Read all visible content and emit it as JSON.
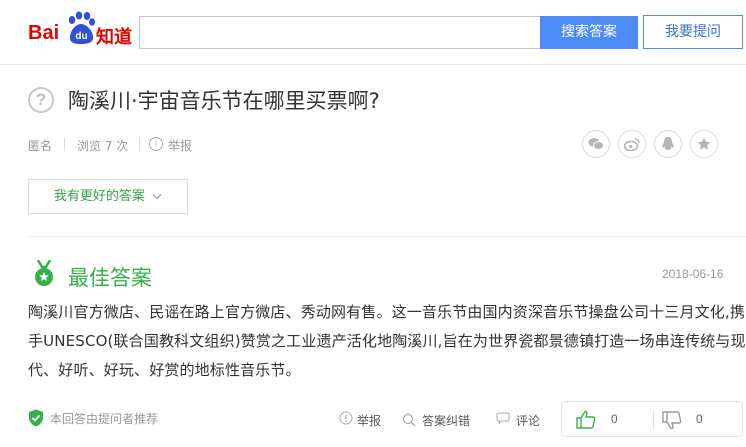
{
  "header": {
    "logo_bai": "Bai",
    "logo_du": "du",
    "logo_zhidao": "知道",
    "search_placeholder": "",
    "search_button": "搜索答案",
    "ask_button": "我要提问"
  },
  "question": {
    "title": "陶溪川·宇宙音乐节在哪里买票啊?",
    "author": "匿名",
    "views": "浏览 7 次",
    "report": "举报",
    "better_answer_button": "我有更好的答案",
    "share_icons": [
      "wechat-icon",
      "weibo-icon",
      "qq-icon",
      "favorite-icon"
    ]
  },
  "best_answer": {
    "label": "最佳答案",
    "date": "2018-06-16",
    "content": "陶溪川官方微店、民谣在路上官方微店、秀动网有售。这一音乐节由国内资深音乐节操盘公司十三月文化,携手UNESCO(联合国教科文组织)赞赏之工业遗产活化地陶溪川,旨在为世界瓷都景德镇打造一场串连传统与现代、好听、好玩、好赏的地标性音乐节。",
    "recommend": "本回答由提问者推荐",
    "actions": {
      "report": "举报",
      "correct": "答案纠错",
      "comment": "评论"
    },
    "likes": "0",
    "dislikes": "0"
  },
  "colors": {
    "brand_red": "#e10601",
    "brand_blue": "#4e8cf5",
    "green": "#37b14b"
  }
}
